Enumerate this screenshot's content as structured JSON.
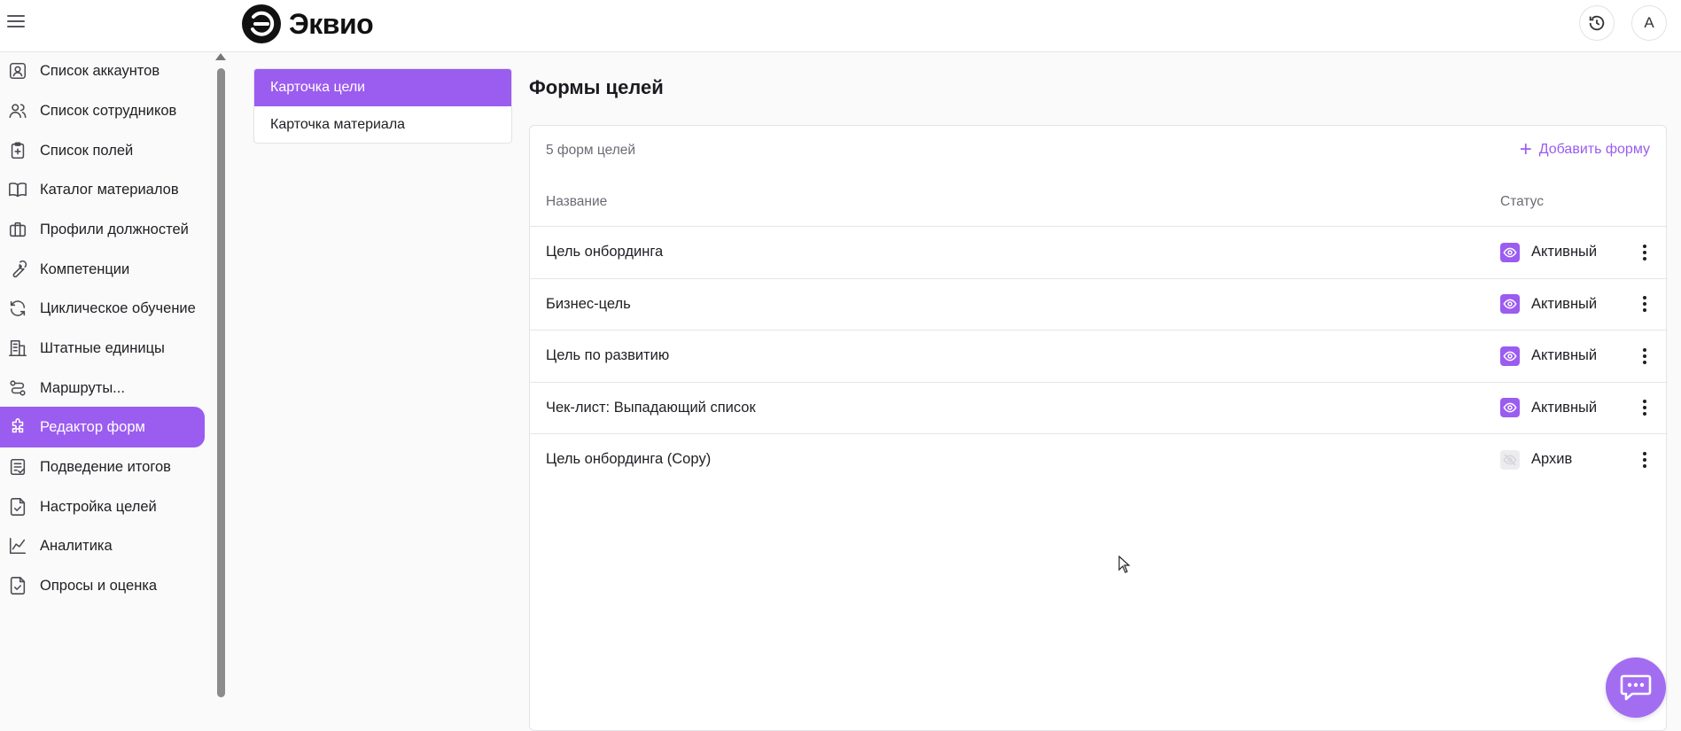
{
  "app": {
    "logo_text": "Эквио"
  },
  "header": {
    "avatar_letter": "A"
  },
  "sidebar": {
    "items": [
      {
        "label": "Список аккаунтов",
        "icon": "account-icon"
      },
      {
        "label": "Список сотрудников",
        "icon": "users-icon"
      },
      {
        "label": "Список полей",
        "icon": "clipboard-icon"
      },
      {
        "label": "Каталог материалов",
        "icon": "book-icon"
      },
      {
        "label": "Профили должностей",
        "icon": "briefcase-icon"
      },
      {
        "label": "Компетенции",
        "icon": "wrench-icon"
      },
      {
        "label": "Циклическое обучение",
        "icon": "refresh-icon"
      },
      {
        "label": "Штатные единицы",
        "icon": "building-icon"
      },
      {
        "label": "Маршруты...",
        "icon": "route-icon"
      },
      {
        "label": "Редактор форм",
        "icon": "puzzle-icon",
        "active": true
      },
      {
        "label": "Подведение итогов",
        "icon": "checklist-icon"
      },
      {
        "label": "Настройка целей",
        "icon": "file-check-icon"
      },
      {
        "label": "Аналитика",
        "icon": "chart-icon"
      },
      {
        "label": "Опросы и оценка",
        "icon": "file-check-icon"
      }
    ]
  },
  "subnav": {
    "items": [
      {
        "label": "Карточка цели",
        "active": true
      },
      {
        "label": "Карточка материала",
        "active": false
      }
    ]
  },
  "main": {
    "title": "Формы целей",
    "count": "5 форм целей",
    "add_label": "Добавить форму",
    "columns": {
      "name": "Название",
      "status": "Статус"
    },
    "rows": [
      {
        "name": "Цель онбординга",
        "status": "Активный",
        "state": "active"
      },
      {
        "name": "Бизнес-цель",
        "status": "Активный",
        "state": "active"
      },
      {
        "name": "Цель по развитию",
        "status": "Активный",
        "state": "active"
      },
      {
        "name": "Чек-лист: Выпадающий список",
        "status": "Активный",
        "state": "active"
      },
      {
        "name": "Цель онбординга (Copy)",
        "status": "Архив",
        "state": "archive"
      }
    ]
  },
  "colors": {
    "accent": "#9b5cf0",
    "chat": "#a36df2",
    "archive": "#ececef"
  }
}
